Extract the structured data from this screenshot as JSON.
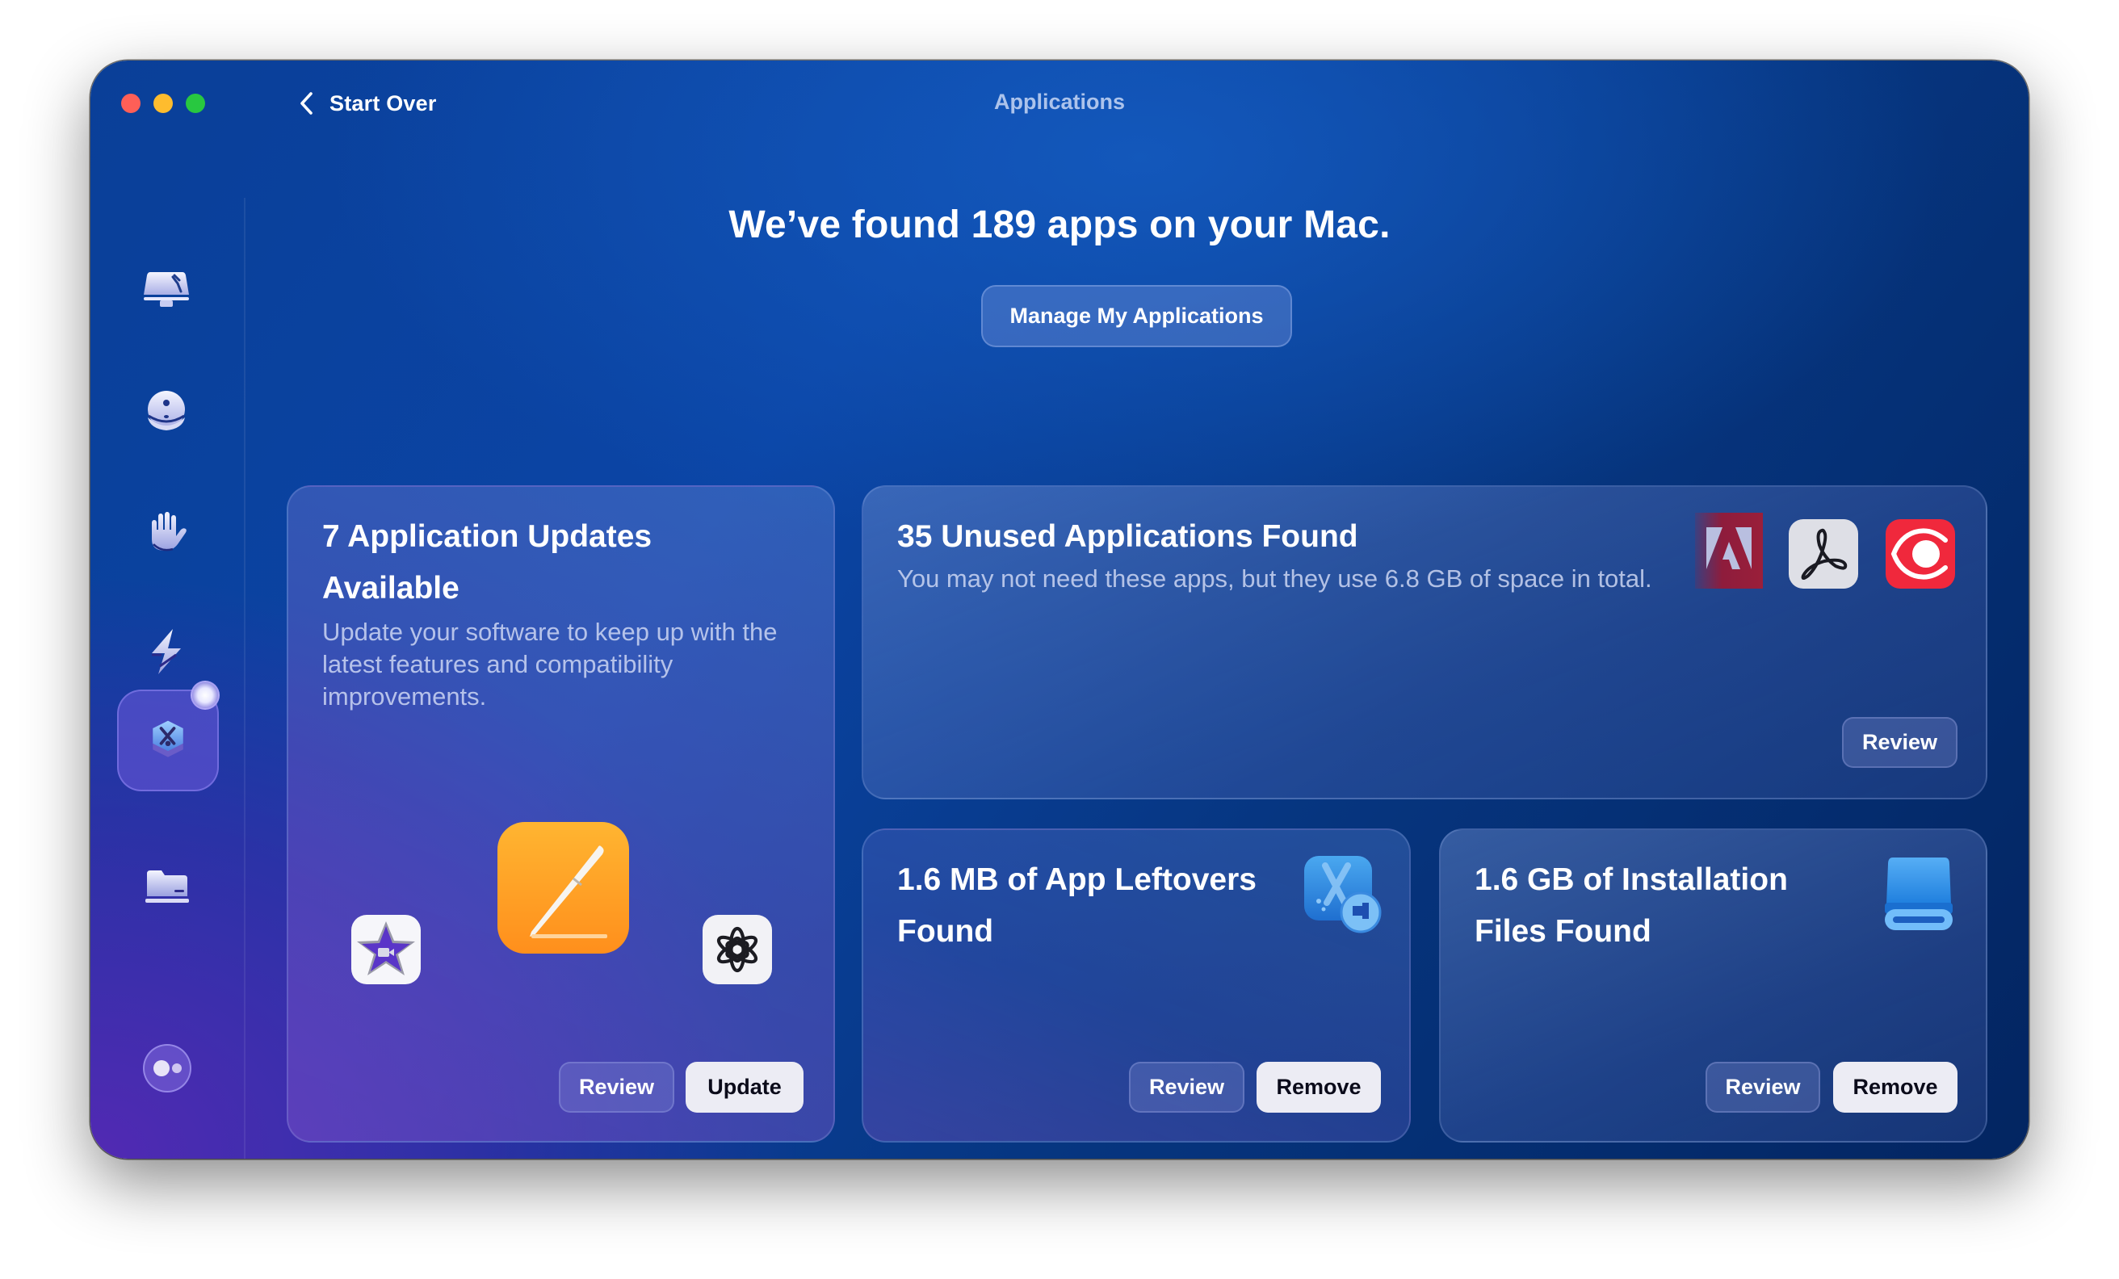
{
  "window": {
    "title": "Applications",
    "back_label": "Start Over"
  },
  "sidebar": {
    "items": [
      {
        "name": "cleanup",
        "icon": "cleanup-icon"
      },
      {
        "name": "protection",
        "icon": "protection-icon"
      },
      {
        "name": "privacy",
        "icon": "privacy-hand-icon"
      },
      {
        "name": "performance",
        "icon": "performance-bolt-icon"
      },
      {
        "name": "applications",
        "icon": "applications-icon",
        "active": true
      },
      {
        "name": "my-clutter",
        "icon": "folder-icon"
      }
    ],
    "assistant_icon": "assistant-icon"
  },
  "header": {
    "headline": "We’ve found 189 apps on your Mac.",
    "manage_button": "Manage My Applications"
  },
  "cards": {
    "updates": {
      "title_line1": "7 Application Updates",
      "title_line2": "Available",
      "description": "Update your software to keep up with the latest features and compatibility improvements.",
      "apps": [
        "iMovie",
        "Pages",
        "ChatGPT"
      ],
      "review_label": "Review",
      "action_label": "Update"
    },
    "unused": {
      "title": "35 Unused Applications Found",
      "description": "You may not need these apps, but they use 6.8 GB of space in total.",
      "apps": [
        "Adobe Creative Cloud",
        "Adobe Acrobat",
        "PDF Expert"
      ],
      "review_label": "Review"
    },
    "leftovers": {
      "title_line1": "1.6 MB of App Leftovers",
      "title_line2": "Found",
      "review_label": "Review",
      "action_label": "Remove"
    },
    "installs": {
      "title_line1": "1.6 GB of Installation",
      "title_line2": "Files Found",
      "review_label": "Review",
      "action_label": "Remove"
    }
  },
  "colors": {
    "traffic_red": "#fe5f57",
    "traffic_yellow": "#febc2e",
    "traffic_green": "#28c840",
    "primary_button_bg": "#ececf4",
    "pages_orange": "#ff9f1a",
    "pdfexpert_red": "#f0283c"
  }
}
